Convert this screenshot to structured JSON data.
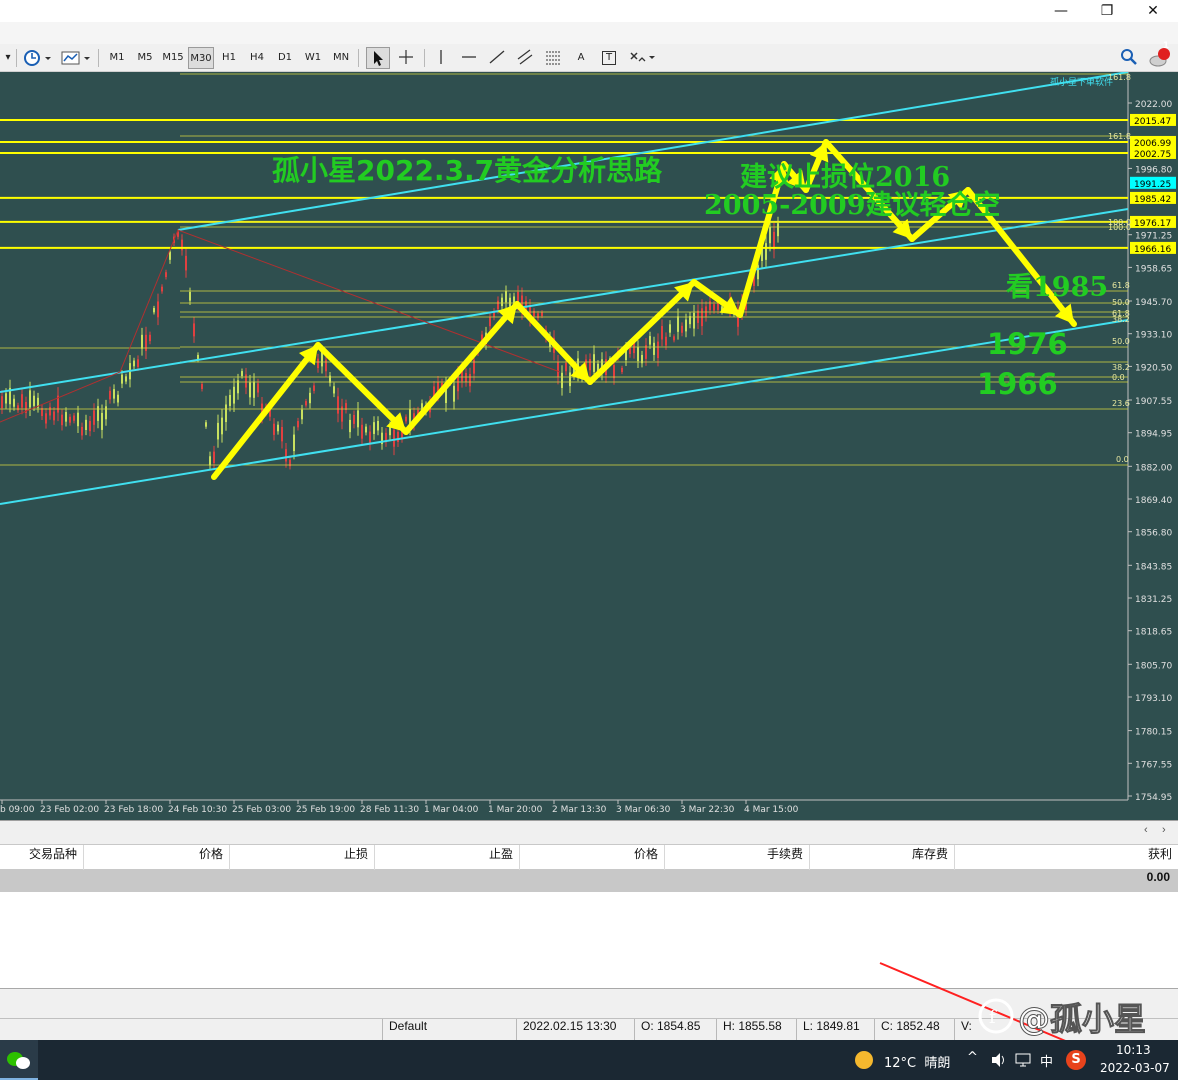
{
  "window": {
    "minimize_icon": "—",
    "maximize_icon": "❐",
    "close_icon": "✕"
  },
  "menubar": {
    "mdi_minimize": "–",
    "mdi_restore": "⧉",
    "mdi_close": "✕",
    "notification_count": "1"
  },
  "toolbar": {
    "timeframes": [
      "M1",
      "M5",
      "M15",
      "M30",
      "H1",
      "H4",
      "D1",
      "W1",
      "MN"
    ],
    "active_timeframe": "M30",
    "tool_text_label": "A",
    "tool_textlabel_label": "T"
  },
  "chart": {
    "background_color": "#2f4f4f",
    "price_axis_labels": [
      "2022.00",
      "1996.80",
      "1971.25",
      "1958.65",
      "1945.70",
      "1933.10",
      "1920.50",
      "1907.55",
      "1894.95",
      "1882.00",
      "1869.40",
      "1856.80",
      "1843.85",
      "1831.25",
      "1818.65",
      "1805.70",
      "1793.10",
      "1780.15",
      "1767.55",
      "1754.95"
    ],
    "highlighted_prices": [
      "2015.47",
      "2006.99",
      "2002.75",
      "1985.42",
      "1976.17",
      "1966.16"
    ],
    "current_price": "1991.25",
    "fib_labels": [
      "161.8",
      "161.8",
      "100.0",
      "100.0",
      "61.8",
      "50.0",
      "61.8",
      "38.2",
      "50.0",
      "38.2",
      "0.0",
      "23.6",
      "0.0"
    ],
    "time_labels": [
      "b 09:00",
      "23 Feb 02:00",
      "23 Feb 18:00",
      "24 Feb 10:30",
      "25 Feb 03:00",
      "25 Feb 19:00",
      "28 Feb 11:30",
      "1 Mar 04:00",
      "1 Mar 20:00",
      "2 Mar 13:30",
      "3 Mar 06:30",
      "3 Mar 22:30",
      "4 Mar 15:00"
    ],
    "annotations": {
      "title": "孤小星2022.3.7黄金分析思路",
      "stop_loss": "建议止损位2016",
      "short_zone": "2005-2009建议轻仓空",
      "target_1985": "看1985",
      "target_1976": "1976",
      "target_1966": "1966"
    },
    "channel_label": "孤小星下单软件",
    "colors": {
      "annotation_green": "#22cc22",
      "arrow_yellow": "#ffff00",
      "channel_cyan": "#40e0f0",
      "level_yellow": "#ffff00",
      "price_label_cyan": "#00ffff"
    }
  },
  "terminal": {
    "columns": [
      "交易品种",
      "价格",
      "止损",
      "止盈",
      "价格",
      "手续费",
      "库存费",
      "获利"
    ],
    "total_profit": "0.00"
  },
  "statusbar": {
    "profile": "Default",
    "datetime": "2022.02.15 13:30",
    "open": "O: 1854.85",
    "high": "H: 1855.58",
    "low": "L: 1849.81",
    "close": "C: 1852.48",
    "volume": "V:"
  },
  "watermark": "@孤小星",
  "taskbar": {
    "weather": "12°C  晴朗",
    "ime": "中",
    "ime_brand": "S",
    "time": "10:13",
    "date": "2022-03-07"
  }
}
